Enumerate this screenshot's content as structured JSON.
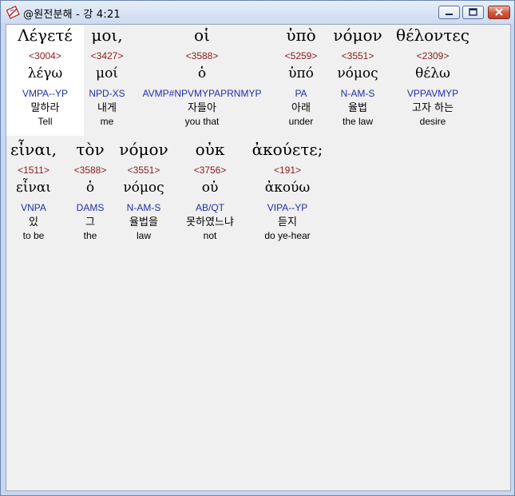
{
  "window": {
    "title": "@원전분해 - 강 4:21"
  },
  "line1": [
    {
      "greek": "Λέγετέ",
      "strong": "<3004>",
      "lemma": "λέγω",
      "morph": "VMPA--YP",
      "korean": "말하라",
      "english": "Tell",
      "selected": true
    },
    {
      "greek": "μοι,",
      "strong": "<3427>",
      "lemma": "μοί",
      "morph": "NPD-XS",
      "korean": "내게",
      "english": "me"
    },
    {
      "greek": "οἱ",
      "strong": "<3588>",
      "lemma": "ὁ",
      "morph": "AVMP#NPVMYPAPRNMYP",
      "korean": "자들아",
      "english": "you that"
    },
    {
      "greek": "ὑπὸ",
      "strong": "<5259>",
      "lemma": "ὑπό",
      "morph": "PA",
      "korean": "아래",
      "english": "under"
    },
    {
      "greek": "νόμον",
      "strong": "<3551>",
      "lemma": "νόμος",
      "morph": "N-AM-S",
      "korean": "율법",
      "english": "the law"
    },
    {
      "greek": "θέλοντες",
      "strong": "<2309>",
      "lemma": "θέλω",
      "morph": "VPPAVMYP",
      "korean": "고자 하는",
      "english": "desire"
    }
  ],
  "line2": [
    {
      "greek": "εἶναι,",
      "strong": "<1511>",
      "lemma": "εἶναι",
      "morph": "VNPA",
      "korean": "있",
      "english": "to be"
    },
    {
      "greek": "τὸν",
      "strong": "<3588>",
      "lemma": "ὁ",
      "morph": "DAMS",
      "korean": "그",
      "english": "the"
    },
    {
      "greek": "νόμον",
      "strong": "<3551>",
      "lemma": "νόμος",
      "morph": "N-AM-S",
      "korean": "율법을",
      "english": "law"
    },
    {
      "greek": "οὐκ",
      "strong": "<3756>",
      "lemma": "οὐ",
      "morph": "AB/QT",
      "korean": "못하였느냐",
      "english": "not"
    },
    {
      "greek": "ἀκούετε;",
      "strong": "<191>",
      "lemma": "ἀκούω",
      "morph": "VIPA--YP",
      "korean": "듣지",
      "english": "do ye-hear"
    }
  ],
  "colors": {
    "strong": "#8b1a1a",
    "morph": "#1f2fa8",
    "client_bg": "#f0f0f0",
    "selected_bg": "#ffffff"
  },
  "icons": {
    "app": "book-pen-icon",
    "minimize": "minimize-icon",
    "maximize": "maximize-icon",
    "close": "close-icon"
  }
}
